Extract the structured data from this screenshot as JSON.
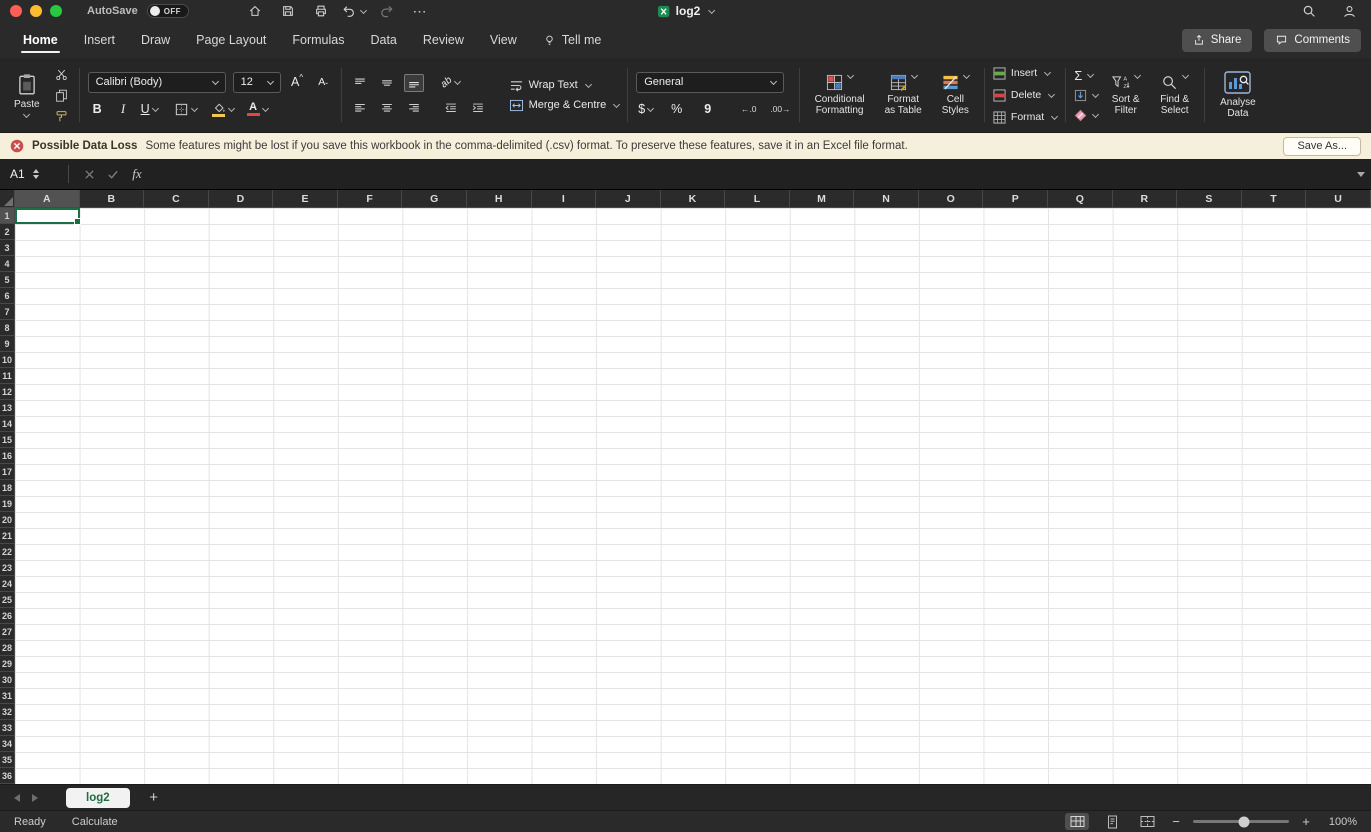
{
  "titlebar": {
    "autosave_label": "AutoSave",
    "autosave_state": "OFF",
    "doc_title": "log2",
    "more_glyph": "⋯"
  },
  "ribbon_tabs": {
    "home": "Home",
    "insert": "Insert",
    "draw": "Draw",
    "page_layout": "Page Layout",
    "formulas": "Formulas",
    "data": "Data",
    "review": "Review",
    "view": "View",
    "tell_me": "Tell me"
  },
  "top_actions": {
    "share": "Share",
    "comments": "Comments"
  },
  "ribbon": {
    "paste": "Paste",
    "font_name": "Calibri (Body)",
    "font_size": "12",
    "grow_font_glyph": "A",
    "shrink_font_glyph": "A",
    "bold_glyph": "B",
    "italic_glyph": "I",
    "underline_glyph": "U",
    "orientation_glyph": "ab",
    "wrap_text": "Wrap Text",
    "merge_centre": "Merge & Centre",
    "number_format": "General",
    "currency_glyph": "$",
    "percent_glyph": "%",
    "comma_glyph": "9",
    "increase_decimal_glyph": "←.0",
    "decrease_decimal_glyph": ".00→",
    "conditional_line1": "Conditional",
    "conditional_line2": "Formatting",
    "format_table_line1": "Format",
    "format_table_line2": "as Table",
    "cell_styles_line1": "Cell",
    "cell_styles_line2": "Styles",
    "insert": "Insert",
    "delete": "Delete",
    "format": "Format",
    "autosum_glyph": "Σ",
    "sort_line1": "Sort &",
    "sort_line2": "Filter",
    "find_line1": "Find &",
    "find_line2": "Select",
    "analyse_line1": "Analyse",
    "analyse_line2": "Data"
  },
  "warning_bar": {
    "title": "Possible Data Loss",
    "message": "Some features might be lost if you save this workbook in the comma-delimited (.csv) format. To preserve these features, save it in an Excel file format.",
    "save_as": "Save As..."
  },
  "formula_bar": {
    "cell_reference": "A1",
    "fx_glyph": "fx",
    "value": ""
  },
  "grid": {
    "columns": [
      "A",
      "B",
      "C",
      "D",
      "E",
      "F",
      "G",
      "H",
      "I",
      "J",
      "K",
      "L",
      "M",
      "N",
      "O",
      "P",
      "Q",
      "R",
      "S",
      "T",
      "U"
    ],
    "row_count": 36,
    "selected_cell": "A1",
    "selected_column": "A",
    "selected_row": "1"
  },
  "sheet_tabs": {
    "active_tab": "log2",
    "add_glyph": "+"
  },
  "status_bar": {
    "mode": "Ready",
    "calculate": "Calculate",
    "zoom_out_glyph": "−",
    "zoom_in_glyph": "+",
    "zoom": "100%"
  },
  "colors": {
    "excel_green": "#1e7145",
    "selection_border": "#1a6e44",
    "warning_bg": "#f6efdb",
    "traffic_red": "#ff5f57",
    "traffic_yellow": "#febc2e",
    "traffic_green": "#28c840"
  }
}
